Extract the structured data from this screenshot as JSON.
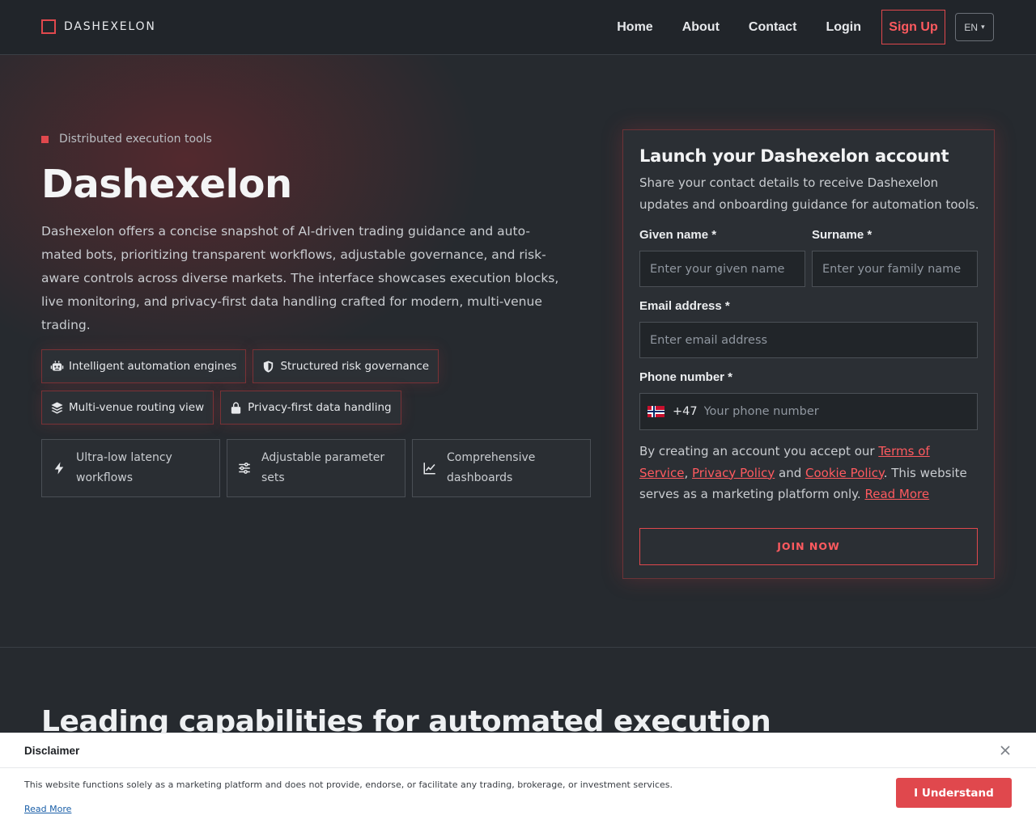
{
  "header": {
    "brand": "DASHEXELON",
    "nav": [
      "Home",
      "About",
      "Contact",
      "Login"
    ],
    "signup_label": "Sign Up",
    "lang_label": "EN",
    "lang_caret": "▾"
  },
  "hero": {
    "eyebrow": "Distributed execution tools",
    "title": "Dashexelon",
    "description": "Dashexelon offers a concise snapshot of AI-driven trading guidance and auto-mated bots, prioritizing transparent workflows, adjustable governance, and risk-aware controls across diverse markets. The interface showcases execution blocks, live monitoring, and privacy-first data handling crafted for modern, multi-venue trading.",
    "pills": [
      {
        "icon": "robot-icon",
        "label": "Intelligent automation engines"
      },
      {
        "icon": "shield-icon",
        "label": "Structured risk governance"
      },
      {
        "icon": "layers-icon",
        "label": "Multi-venue routing view"
      },
      {
        "icon": "lock-icon",
        "label": "Privacy-first data handling"
      }
    ],
    "features": [
      {
        "icon": "bolt-icon",
        "label": "Ultra-low latency workflows"
      },
      {
        "icon": "sliders-icon",
        "label": "Adjustable parameter sets"
      },
      {
        "icon": "chart-line-icon",
        "label": "Comprehensive dashboards"
      }
    ]
  },
  "form": {
    "title": "Launch your Dashexelon account",
    "subtitle": "Share your contact details to receive Dashexelon updates and onboarding guidance for automation tools.",
    "given_label": "Given name *",
    "given_placeholder": "Enter your given name",
    "given_value": "",
    "surname_label": "Surname *",
    "surname_placeholder": "Enter your family name",
    "surname_value": "",
    "email_label": "Email address *",
    "email_placeholder": "Enter email address",
    "email_value": "",
    "phone_label": "Phone number *",
    "phone_flag": "norway-flag",
    "phone_code": "+47",
    "phone_placeholder": "Your phone number",
    "phone_value": "",
    "terms_prefix": "By creating an account you accept our ",
    "terms_link": "Terms of Service",
    "terms_comma": ",",
    "privacy_link": "Privacy Policy",
    "and_text": " and ",
    "cookie_link": "Cookie Policy",
    "terms_suffix": ". This website serves as a marketing platform only. ",
    "read_more": "Read More",
    "submit_label": "JOIN NOW"
  },
  "capabilities": {
    "title": "Leading capabilities for automated execution"
  },
  "disclaimer": {
    "title": "Disclaimer",
    "text": "This website functions solely as a marketing platform and does not provide, endorse, or facilitate any trading, brokerage, or investment services.",
    "read_more": "Read More",
    "button": "I Understand"
  },
  "colors": {
    "accent": "#e0484d",
    "background": "#262a2f",
    "card": "#2b2f34"
  }
}
